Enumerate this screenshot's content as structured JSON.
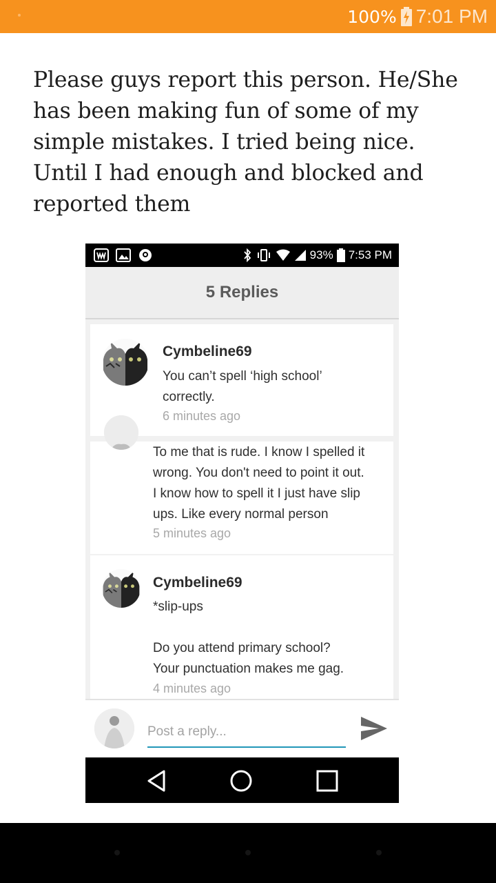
{
  "status_bar": {
    "battery": "100%",
    "time": "7:01 PM",
    "battery_icon": "battery-charging-icon"
  },
  "post": {
    "text": "Please guys report this person. He/She has been making fun of some of my simple mistakes. I tried being nice. Until I had enough and blocked and reported them"
  },
  "screenshot": {
    "status": {
      "battery": "93%",
      "time": "7:53 PM"
    },
    "header_title": "5 Replies",
    "comments": [
      {
        "username": "Cymbeline69",
        "lines": [
          "You can’t spell ‘high school’",
          "correctly."
        ],
        "time": "6 minutes ago"
      },
      {
        "username": "",
        "lines": [
          "To me that is rude. I know I spelled it",
          "wrong. You don't need to point it out.",
          "I know how to spell it I just have slip",
          "ups. Like every normal person"
        ],
        "time": "5 minutes ago"
      },
      {
        "username": "Cymbeline69",
        "lines": [
          "*slip-ups",
          "",
          "Do you attend primary school?",
          "Your punctuation makes me gag."
        ],
        "time": "4 minutes ago"
      }
    ],
    "reply": {
      "placeholder": "Post a reply..."
    },
    "accent_color": "#2196b8"
  },
  "colors": {
    "status_bar": "#f7921e"
  }
}
